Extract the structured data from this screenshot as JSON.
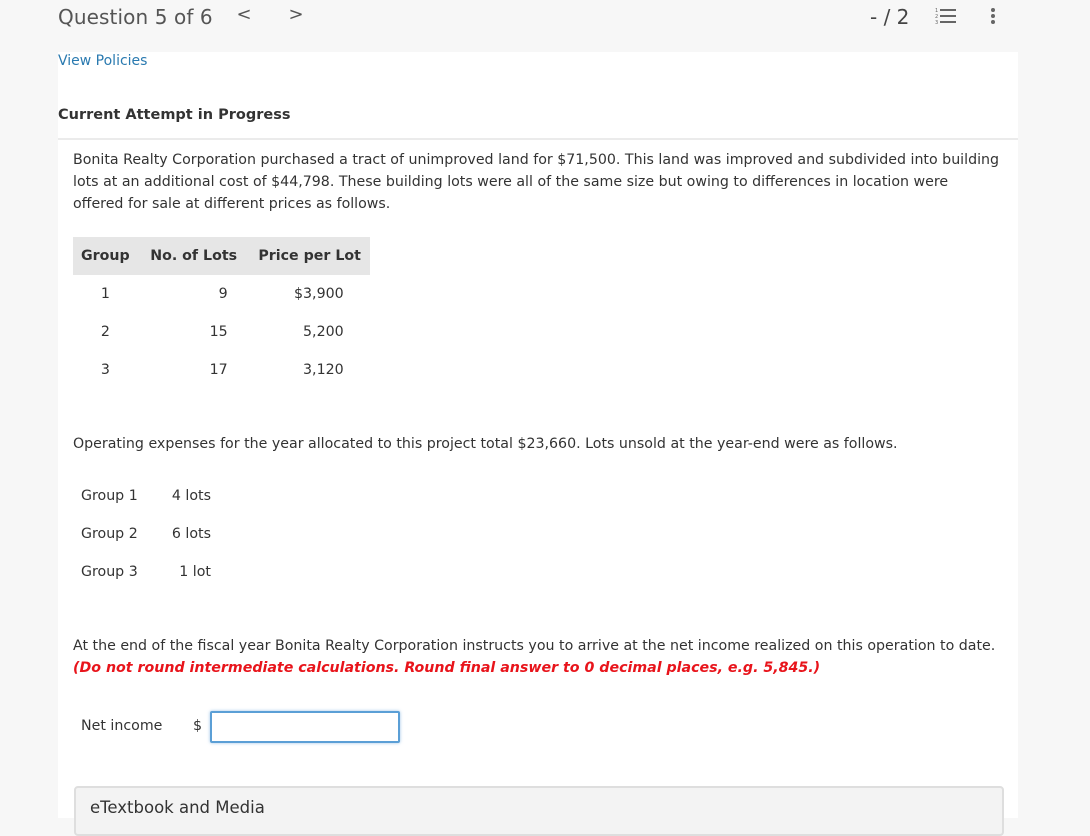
{
  "header": {
    "question_label": "Question 5 of 6",
    "prev_icon": "chevron-left-icon",
    "next_icon": "chevron-right-icon",
    "prev_glyph": "<",
    "next_glyph": ">",
    "score": "- / 2",
    "list_icon": "numbered-list-icon",
    "more_icon": "more-vertical-icon"
  },
  "links": {
    "view_policies": "View Policies"
  },
  "attempt_heading": "Current Attempt in Progress",
  "problem": {
    "intro": "Bonita Realty Corporation purchased a tract of unimproved land for $71,500. This land was improved and subdivided into building lots at an additional cost of $44,798. These building lots were all of the same size but owing to differences in location were offered for sale at different prices as follows.",
    "lots_table": {
      "headers": [
        "Group",
        "No. of Lots",
        "Price per Lot"
      ],
      "rows": [
        [
          "1",
          "9",
          "$3,900"
        ],
        [
          "2",
          "15",
          "5,200"
        ],
        [
          "3",
          "17",
          "3,120"
        ]
      ]
    },
    "expenses_text": "Operating expenses for the year allocated to this project total $23,660. Lots unsold at the year-end were as follows.",
    "unsold_table": {
      "rows": [
        [
          "Group 1",
          "4 lots"
        ],
        [
          "Group 2",
          "6 lots"
        ],
        [
          "Group 3",
          "1 lot"
        ]
      ]
    },
    "instruction": "At the end of the fiscal year Bonita Realty Corporation instructs you to arrive at the net income realized on this operation to date.",
    "hint": "(Do not round intermediate calculations. Round final answer to 0 decimal places, e.g. 5,845.)"
  },
  "answer": {
    "label": "Net income",
    "currency": "$",
    "value": ""
  },
  "etextbook": {
    "label": "eTextbook and Media"
  }
}
